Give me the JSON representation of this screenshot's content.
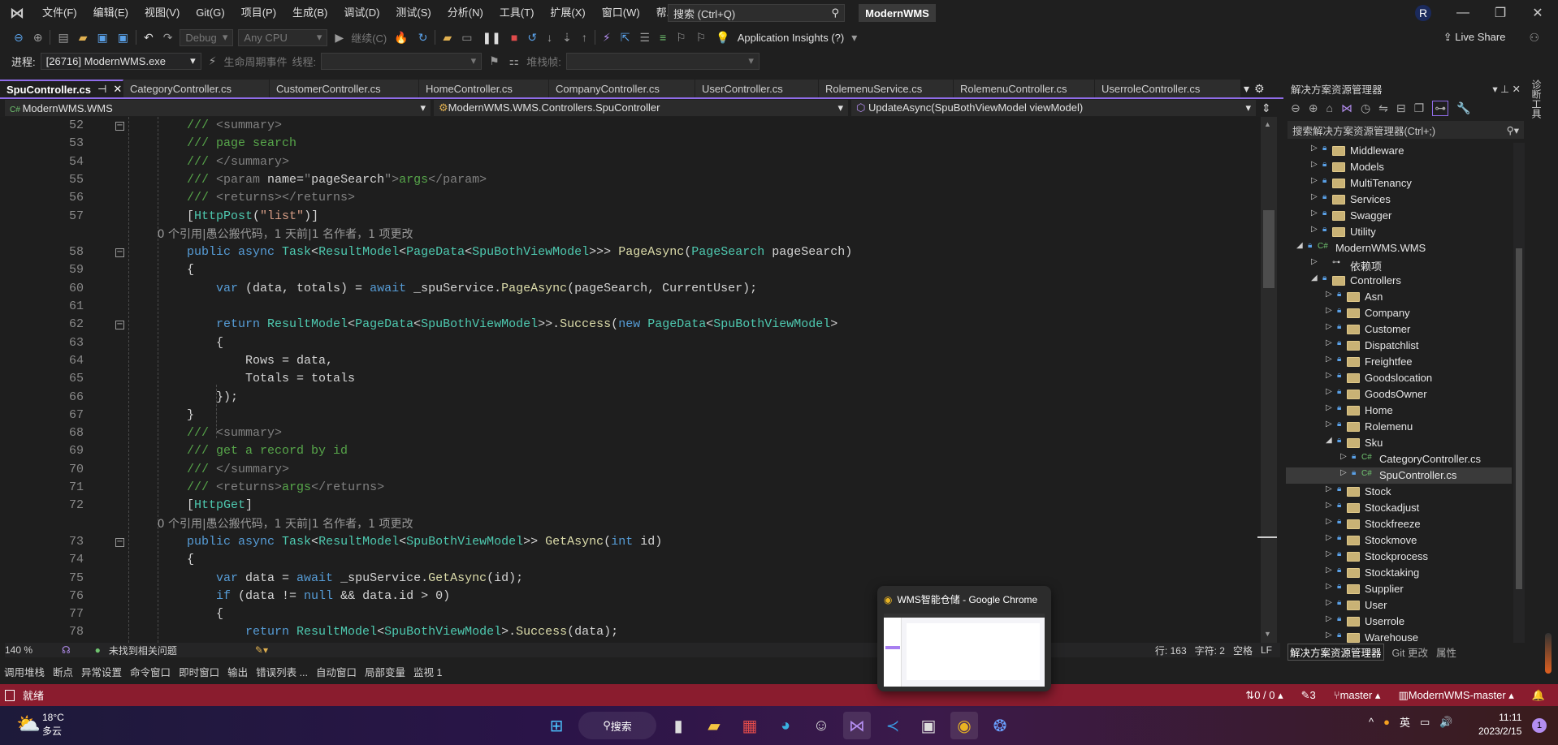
{
  "menubar": {
    "items": [
      "文件(F)",
      "编辑(E)",
      "视图(V)",
      "Git(G)",
      "项目(P)",
      "生成(B)",
      "调试(D)",
      "测试(S)",
      "分析(N)",
      "工具(T)",
      "扩展(X)",
      "窗口(W)",
      "帮助(H)"
    ],
    "search_placeholder": "搜索 (Ctrl+Q)",
    "solution_name": "ModernWMS",
    "avatar": "R"
  },
  "toolbar1": {
    "config": "Debug",
    "platform": "Any CPU",
    "continue": "继续(C)",
    "app_insights": "Application Insights (?)",
    "live_share": "Live Share"
  },
  "toolbar2": {
    "process_label": "进程:",
    "process": "[26716] ModernWMS.exe",
    "lifecycle": "生命周期事件",
    "thread_label": "线程:",
    "stack_label": "堆栈帧:"
  },
  "tabs": [
    "SpuController.cs",
    "CategoryController.cs",
    "CustomerController.cs",
    "HomeController.cs",
    "CompanyController.cs",
    "UserController.cs",
    "RolemenuService.cs",
    "RolemenuController.cs",
    "UserroleController.cs"
  ],
  "navbar": {
    "project": "ModernWMS.WMS",
    "class": "ModernWMS.WMS.Controllers.SpuController",
    "member": "UpdateAsync(SpuBothViewModel viewModel)"
  },
  "code": [
    {
      "n": "52",
      "fold": true,
      "tok": [
        [
          "c",
          "        /// "
        ],
        [
          "cg",
          "<summary>"
        ]
      ]
    },
    {
      "n": "53",
      "tok": [
        [
          "c",
          "        /// page search"
        ]
      ]
    },
    {
      "n": "54",
      "tok": [
        [
          "c",
          "        /// "
        ],
        [
          "cg",
          "</summary>"
        ]
      ]
    },
    {
      "n": "55",
      "tok": [
        [
          "c",
          "        /// "
        ],
        [
          "cg",
          "<param "
        ],
        [
          "w",
          "name="
        ],
        [
          "cg",
          "\""
        ],
        [
          "w",
          "pageSearch"
        ],
        [
          "cg",
          "\">"
        ],
        [
          "c",
          "args"
        ],
        [
          "cg",
          "</param>"
        ]
      ]
    },
    {
      "n": "56",
      "tok": [
        [
          "c",
          "        /// "
        ],
        [
          "cg",
          "<returns></returns>"
        ]
      ]
    },
    {
      "n": "57",
      "tok": [
        [
          "p",
          "        ["
        ],
        [
          "t",
          "HttpPost"
        ],
        [
          "p",
          "("
        ],
        [
          "s",
          "\"list\""
        ],
        [
          "p",
          ")]"
        ]
      ]
    },
    {
      "lens": "        0 个引用|愚公搬代码，1 天前|1 名作者，1 项更改"
    },
    {
      "n": "58",
      "fold": true,
      "tok": [
        [
          "k",
          "        public async "
        ],
        [
          "t",
          "Task"
        ],
        [
          "p",
          "<"
        ],
        [
          "t",
          "ResultModel"
        ],
        [
          "p",
          "<"
        ],
        [
          "t",
          "PageData"
        ],
        [
          "p",
          "<"
        ],
        [
          "t",
          "SpuBothViewModel"
        ],
        [
          "p",
          ">>> "
        ],
        [
          "m",
          "PageAsync"
        ],
        [
          "p",
          "("
        ],
        [
          "t",
          "PageSearch"
        ],
        [
          "w",
          " pageSearch)"
        ]
      ]
    },
    {
      "n": "59",
      "tok": [
        [
          "p",
          "        {"
        ]
      ]
    },
    {
      "n": "60",
      "tok": [
        [
          "k",
          "            var "
        ],
        [
          "w",
          "(data, totals) = "
        ],
        [
          "k",
          "await "
        ],
        [
          "w",
          "_spuService."
        ],
        [
          "m",
          "PageAsync"
        ],
        [
          "w",
          "(pageSearch, CurrentUser);"
        ]
      ]
    },
    {
      "n": "61",
      "tok": []
    },
    {
      "n": "62",
      "fold": true,
      "tok": [
        [
          "k",
          "            return "
        ],
        [
          "t",
          "ResultModel"
        ],
        [
          "p",
          "<"
        ],
        [
          "t",
          "PageData"
        ],
        [
          "p",
          "<"
        ],
        [
          "t",
          "SpuBothViewModel"
        ],
        [
          "p",
          ">>."
        ],
        [
          "m",
          "Success"
        ],
        [
          "p",
          "("
        ],
        [
          "k",
          "new "
        ],
        [
          "t",
          "PageData"
        ],
        [
          "p",
          "<"
        ],
        [
          "t",
          "SpuBothViewModel"
        ],
        [
          "p",
          ">"
        ]
      ]
    },
    {
      "n": "63",
      "tok": [
        [
          "p",
          "            {"
        ]
      ]
    },
    {
      "n": "64",
      "tok": [
        [
          "w",
          "                Rows = data,"
        ]
      ]
    },
    {
      "n": "65",
      "tok": [
        [
          "w",
          "                Totals = totals"
        ]
      ]
    },
    {
      "n": "66",
      "tok": [
        [
          "p",
          "            });"
        ]
      ]
    },
    {
      "n": "67",
      "tok": [
        [
          "p",
          "        }"
        ]
      ]
    },
    {
      "n": "68",
      "tok": [
        [
          "c",
          "        /// "
        ],
        [
          "cg",
          "<summary>"
        ]
      ]
    },
    {
      "n": "69",
      "tok": [
        [
          "c",
          "        /// get a record by id"
        ]
      ]
    },
    {
      "n": "70",
      "tok": [
        [
          "c",
          "        /// "
        ],
        [
          "cg",
          "</summary>"
        ]
      ]
    },
    {
      "n": "71",
      "tok": [
        [
          "c",
          "        /// "
        ],
        [
          "cg",
          "<returns>"
        ],
        [
          "c",
          "args"
        ],
        [
          "cg",
          "</returns>"
        ]
      ]
    },
    {
      "n": "72",
      "tok": [
        [
          "p",
          "        ["
        ],
        [
          "t",
          "HttpGet"
        ],
        [
          "p",
          "]"
        ]
      ]
    },
    {
      "lens": "        0 个引用|愚公搬代码，1 天前|1 名作者，1 项更改"
    },
    {
      "n": "73",
      "fold": true,
      "tok": [
        [
          "k",
          "        public async "
        ],
        [
          "t",
          "Task"
        ],
        [
          "p",
          "<"
        ],
        [
          "t",
          "ResultModel"
        ],
        [
          "p",
          "<"
        ],
        [
          "t",
          "SpuBothViewModel"
        ],
        [
          "p",
          ">> "
        ],
        [
          "m",
          "GetAsync"
        ],
        [
          "p",
          "("
        ],
        [
          "k",
          "int"
        ],
        [
          "w",
          " id)"
        ]
      ]
    },
    {
      "n": "74",
      "tok": [
        [
          "p",
          "        {"
        ]
      ]
    },
    {
      "n": "75",
      "tok": [
        [
          "k",
          "            var "
        ],
        [
          "w",
          "data = "
        ],
        [
          "k",
          "await "
        ],
        [
          "w",
          "_spuService."
        ],
        [
          "m",
          "GetAsync"
        ],
        [
          "w",
          "(id);"
        ]
      ]
    },
    {
      "n": "76",
      "tok": [
        [
          "k",
          "            if "
        ],
        [
          "w",
          "(data != "
        ],
        [
          "k",
          "null"
        ],
        [
          "w",
          " && data.id > 0)"
        ]
      ]
    },
    {
      "n": "77",
      "tok": [
        [
          "p",
          "            {"
        ]
      ]
    },
    {
      "n": "78",
      "tok": [
        [
          "k",
          "                return "
        ],
        [
          "t",
          "ResultModel"
        ],
        [
          "p",
          "<"
        ],
        [
          "t",
          "SpuBothViewModel"
        ],
        [
          "p",
          ">."
        ],
        [
          "m",
          "Success"
        ],
        [
          "w",
          "(data);"
        ]
      ]
    }
  ],
  "editor_status": {
    "zoom": "140 %",
    "issues": "未找到相关问题",
    "line": "行: 163",
    "char": "字符: 2",
    "spaces": "空格",
    "eol": "LF"
  },
  "tool_tabs": [
    "调用堆栈",
    "断点",
    "异常设置",
    "命令窗口",
    "即时窗口",
    "输出",
    "错误列表 ...",
    "自动窗口",
    "局部变量",
    "监视 1"
  ],
  "solution_explorer": {
    "title": "解决方案资源管理器",
    "search_placeholder": "搜索解决方案资源管理器(Ctrl+;)",
    "bottom_tabs": [
      "解决方案资源管理器",
      "Git 更改",
      "属性"
    ],
    "items": [
      {
        "label": "Middleware",
        "level": 1,
        "type": "folder"
      },
      {
        "label": "Models",
        "level": 1,
        "type": "folder"
      },
      {
        "label": "MultiTenancy",
        "level": 1,
        "type": "folder"
      },
      {
        "label": "Services",
        "level": 1,
        "type": "folder"
      },
      {
        "label": "Swagger",
        "level": 1,
        "type": "folder"
      },
      {
        "label": "Utility",
        "level": 1,
        "type": "folder"
      },
      {
        "label": "ModernWMS.WMS",
        "level": 0,
        "type": "project",
        "expanded": true
      },
      {
        "label": "依赖项",
        "level": 1,
        "type": "deps"
      },
      {
        "label": "Controllers",
        "level": 1,
        "type": "folder",
        "expanded": true
      },
      {
        "label": "Asn",
        "level": 2,
        "type": "folder"
      },
      {
        "label": "Company",
        "level": 2,
        "type": "folder"
      },
      {
        "label": "Customer",
        "level": 2,
        "type": "folder"
      },
      {
        "label": "Dispatchlist",
        "level": 2,
        "type": "folder"
      },
      {
        "label": "Freightfee",
        "level": 2,
        "type": "folder"
      },
      {
        "label": "Goodslocation",
        "level": 2,
        "type": "folder"
      },
      {
        "label": "GoodsOwner",
        "level": 2,
        "type": "folder"
      },
      {
        "label": "Home",
        "level": 2,
        "type": "folder"
      },
      {
        "label": "Rolemenu",
        "level": 2,
        "type": "folder"
      },
      {
        "label": "Sku",
        "level": 2,
        "type": "folder",
        "expanded": true
      },
      {
        "label": "CategoryController.cs",
        "level": 3,
        "type": "cs"
      },
      {
        "label": "SpuController.cs",
        "level": 3,
        "type": "cs",
        "selected": true
      },
      {
        "label": "Stock",
        "level": 2,
        "type": "folder"
      },
      {
        "label": "Stockadjust",
        "level": 2,
        "type": "folder"
      },
      {
        "label": "Stockfreeze",
        "level": 2,
        "type": "folder"
      },
      {
        "label": "Stockmove",
        "level": 2,
        "type": "folder"
      },
      {
        "label": "Stockprocess",
        "level": 2,
        "type": "folder"
      },
      {
        "label": "Stocktaking",
        "level": 2,
        "type": "folder"
      },
      {
        "label": "Supplier",
        "level": 2,
        "type": "folder"
      },
      {
        "label": "User",
        "level": 2,
        "type": "folder"
      },
      {
        "label": "Userrole",
        "level": 2,
        "type": "folder"
      },
      {
        "label": "Warehouse",
        "level": 2,
        "type": "folder"
      }
    ]
  },
  "right_strip": "诊断工具",
  "statusbar": {
    "ready": "就绪",
    "sync": "0 / 0",
    "edits": "3",
    "branch": "master",
    "repo": "ModernWMS-master"
  },
  "taskbar": {
    "temp": "18°C",
    "weather": "多云",
    "search": "搜索",
    "ime": "英",
    "time": "11:11",
    "date": "2023/2/15",
    "notifications": "1"
  },
  "popup": {
    "title": "WMS智能仓储 - Google Chrome"
  },
  "colors": {
    "accent": "#8f6ce8",
    "statusbar": "#8a1c2e"
  }
}
